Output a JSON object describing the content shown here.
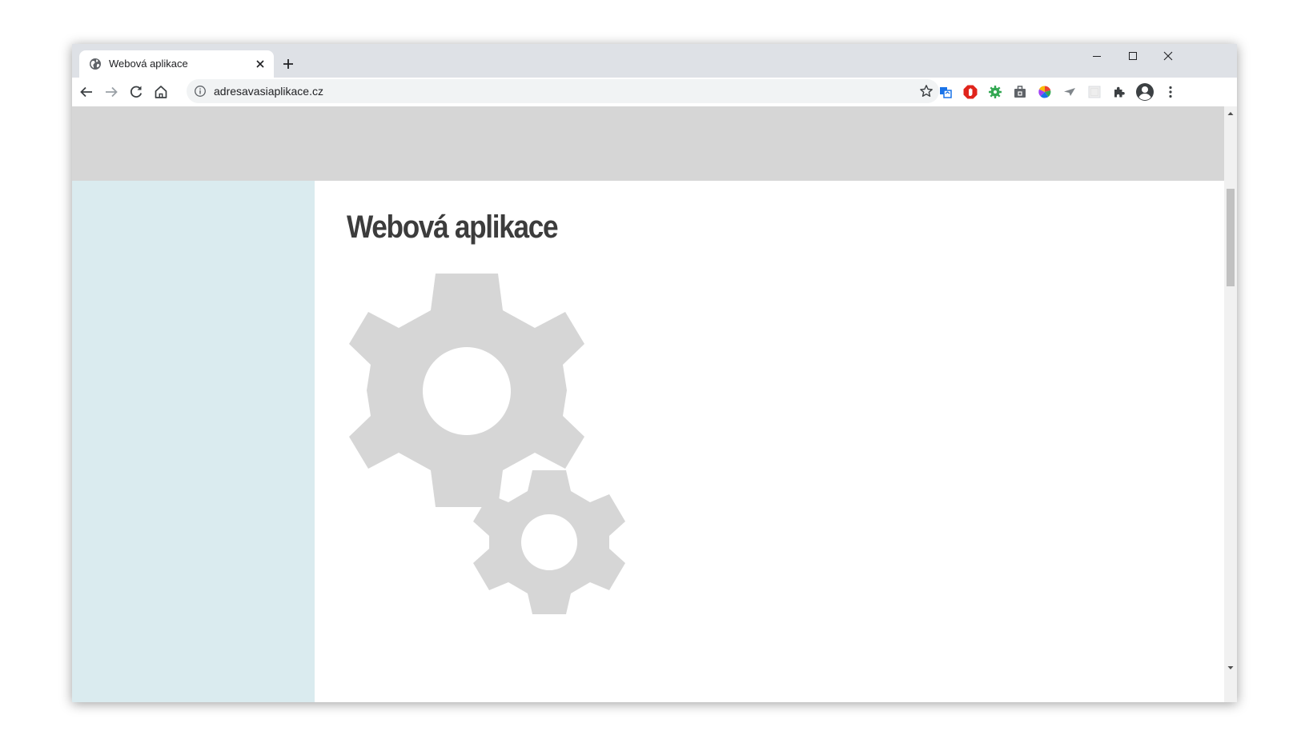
{
  "browser": {
    "tab": {
      "title": "Webová aplikace",
      "favicon": "globe-icon",
      "close_icon": "close-icon"
    },
    "new_tab_icon": "plus-icon",
    "window_controls": [
      "minimize-icon",
      "maximize-icon",
      "close-icon"
    ],
    "nav_icons": [
      "back-arrow-icon",
      "forward-arrow-icon",
      "reload-icon",
      "home-icon"
    ],
    "omnibox": {
      "url": "adresavasiaplikace.cz",
      "info_icon": "info-icon",
      "bookmark_icon": "star-icon"
    },
    "extensions": [
      "translate-extension-icon",
      "adblock-extension-icon",
      "green-gear-extension-icon",
      "briefcase-extension-icon",
      "color-wheel-extension-icon",
      "send-extension-icon",
      "blank-extension-icon",
      "puzzle-icon",
      "profile-avatar-icon",
      "kebab-menu-icon"
    ]
  },
  "page": {
    "title": "Webová aplikace",
    "illustration": "gears-icon"
  },
  "colors": {
    "header_bg": "#d6d6d6",
    "sidebar_bg": "#daebef",
    "gear": "#d6d6d6",
    "title_text": "#3c3c3c",
    "tabstrip_bg": "#dee1e6",
    "omnibox_bg": "#f1f3f4"
  }
}
